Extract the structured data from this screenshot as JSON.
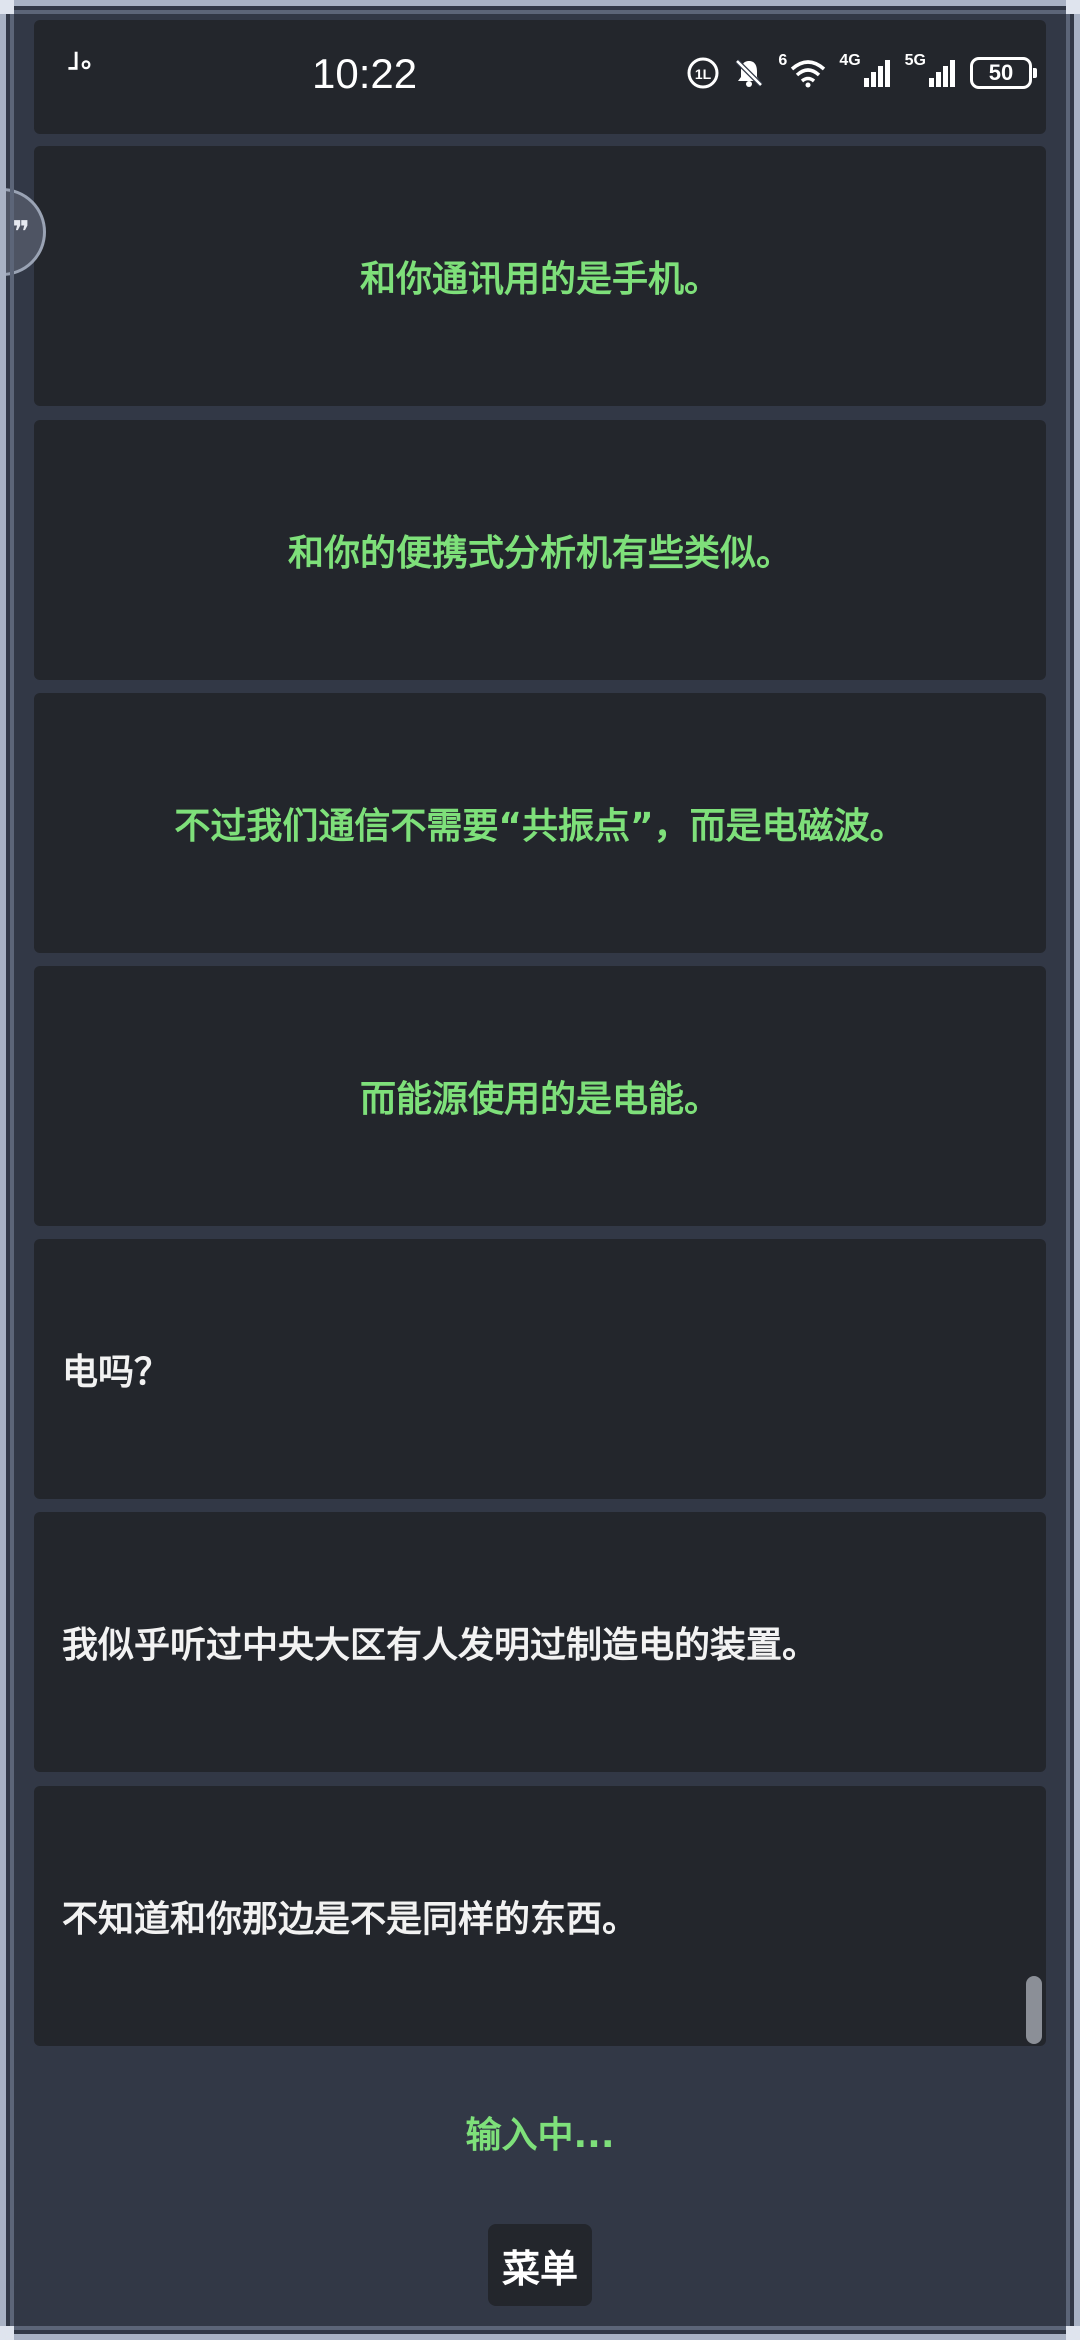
{
  "status_bar": {
    "time": "10:22",
    "notch_text": "」。",
    "battery": "50",
    "wifi_badge": "6",
    "signal_1_label": "4G",
    "signal_2_label": "5G",
    "nfc_glyph": "⊕",
    "bell_glyph": "🔕"
  },
  "chat": {
    "messages": [
      {
        "sender": "partner",
        "text": "和你通讯用的是手机。"
      },
      {
        "sender": "partner",
        "text": "和你的便携式分析机有些类似。"
      },
      {
        "sender": "partner",
        "text": "不过我们通信不需要“共振点”，而是电磁波。"
      },
      {
        "sender": "partner",
        "text": "而能源使用的是电能。"
      },
      {
        "sender": "self",
        "text": "电吗？"
      },
      {
        "sender": "self",
        "text": "我似乎听过中央大区有人发明过制造电的装置。"
      },
      {
        "sender": "self",
        "text": "不知道和你那边是不是同样的东西。"
      }
    ]
  },
  "floating_bubble": {
    "glyph": "❞"
  },
  "footer": {
    "typing_status": "输入中...",
    "menu_label": "菜单"
  },
  "colors": {
    "partner_text": "#7ee07a",
    "self_text": "#f2f2f2",
    "bubble_bg": "#23262c",
    "screen_bg": "#323846"
  }
}
